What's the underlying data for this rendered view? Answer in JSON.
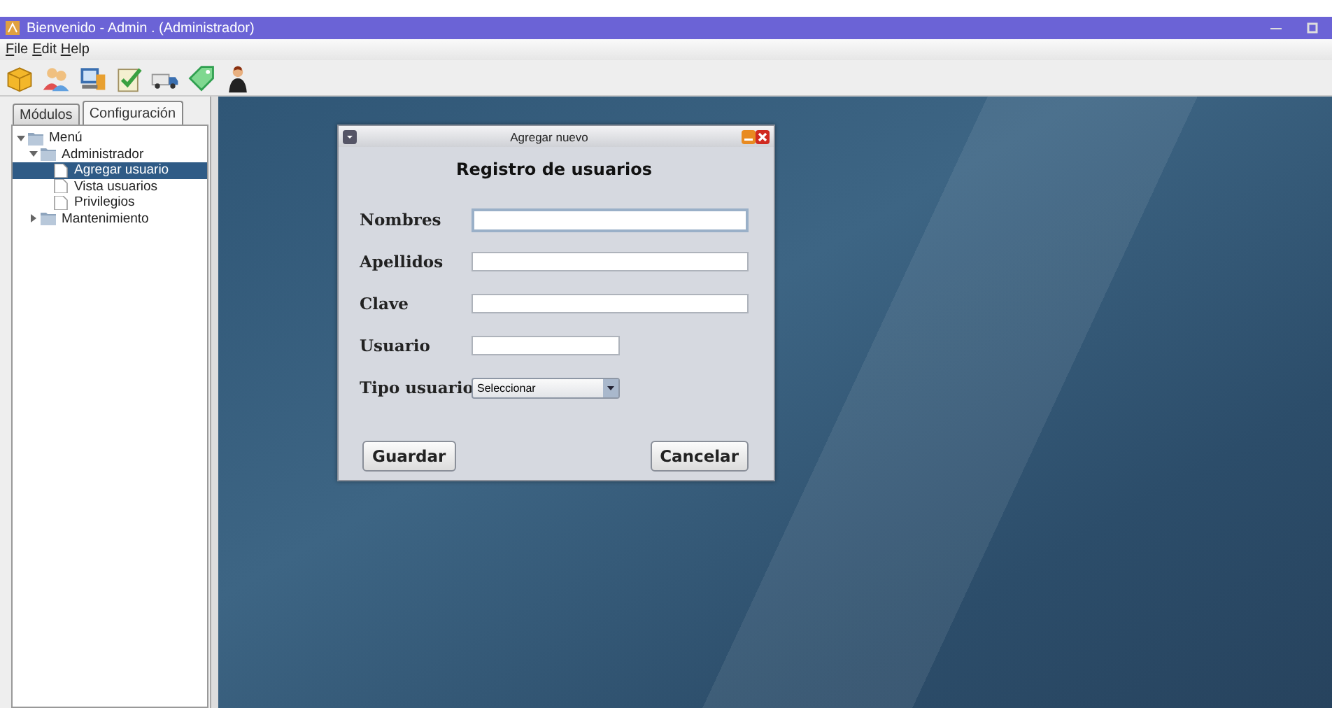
{
  "window": {
    "title": "Bienvenido - Admin . (Administrador)"
  },
  "menu": [
    {
      "label": "File"
    },
    {
      "label": "Edit"
    },
    {
      "label": "Help"
    }
  ],
  "tabs": [
    {
      "label": "Módulos",
      "selected": false
    },
    {
      "label": "Configuración",
      "selected": true
    }
  ],
  "tree": [
    {
      "label": "Menú",
      "kind": "folder",
      "expanded": true,
      "selected": false,
      "children": [
        {
          "label": "Administrador",
          "kind": "folder",
          "expanded": true,
          "selected": false,
          "children": [
            {
              "label": "Agregar usuario",
              "kind": "file",
              "selected": true
            },
            {
              "label": "Vista usuarios",
              "kind": "file",
              "selected": false
            },
            {
              "label": "Privilegios",
              "kind": "file",
              "selected": false
            }
          ]
        },
        {
          "label": "Mantenimiento",
          "kind": "folder",
          "expanded": false,
          "selected": false
        }
      ]
    }
  ],
  "dialog": {
    "title": "Agregar nuevo",
    "heading": "Registro de usuarios",
    "fields": [
      {
        "label": "Nombres",
        "kind": "text",
        "focused": true
      },
      {
        "label": "Apellidos",
        "kind": "text",
        "focused": false
      },
      {
        "label": "Clave",
        "kind": "text",
        "focused": false
      },
      {
        "label": "Usuario",
        "kind": "short",
        "focused": false
      },
      {
        "label": "Tipo usuario",
        "kind": "select",
        "value": "Seleccionar",
        "focused": false
      }
    ],
    "buttons": [
      {
        "label": "Guardar"
      },
      {
        "label": "Cancelar"
      }
    ]
  }
}
